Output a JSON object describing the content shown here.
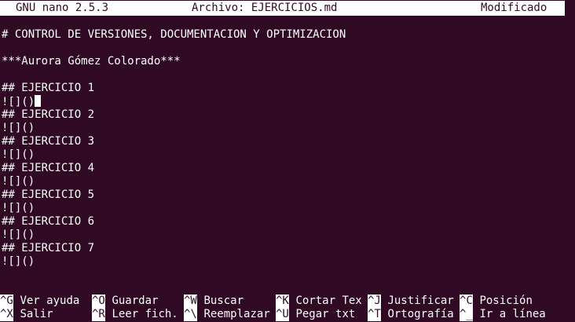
{
  "titlebar": {
    "app": "GNU nano 2.5.3",
    "file": "Archivo: EJERCICIOS.md",
    "status": "Modificado"
  },
  "editor": {
    "lines": [
      "# CONTROL DE VERSIONES, DOCUMENTACION Y OPTIMIZACION",
      "***Aurora Gómez Colorado***",
      "## EJERCICIO 1",
      "![]()",
      "## EJERCICIO 2",
      "![]()",
      "## EJERCICIO 3",
      "![]()",
      "## EJERCICIO 4",
      "![]()",
      "## EJERCICIO 5",
      "![]()",
      "## EJERCICIO 6",
      "![]()",
      "## EJERCICIO 7",
      "![]()"
    ]
  },
  "shortcuts": {
    "row1": [
      {
        "key": "^G",
        "label": "Ver ayuda"
      },
      {
        "key": "^O",
        "label": "Guardar"
      },
      {
        "key": "^W",
        "label": "Buscar"
      },
      {
        "key": "^K",
        "label": "Cortar Tex"
      },
      {
        "key": "^J",
        "label": "Justificar"
      },
      {
        "key": "^C",
        "label": "Posición"
      }
    ],
    "row2": [
      {
        "key": "^X",
        "label": "Salir"
      },
      {
        "key": "^R",
        "label": "Leer fich."
      },
      {
        "key": "^\\",
        "label": "Reemplazar"
      },
      {
        "key": "^U",
        "label": "Pegar txt"
      },
      {
        "key": "^T",
        "label": "Ortografía"
      },
      {
        "key": "^_",
        "label": "Ir a línea"
      }
    ]
  },
  "colors": {
    "background": "#300a24",
    "foreground": "#ffffff"
  }
}
